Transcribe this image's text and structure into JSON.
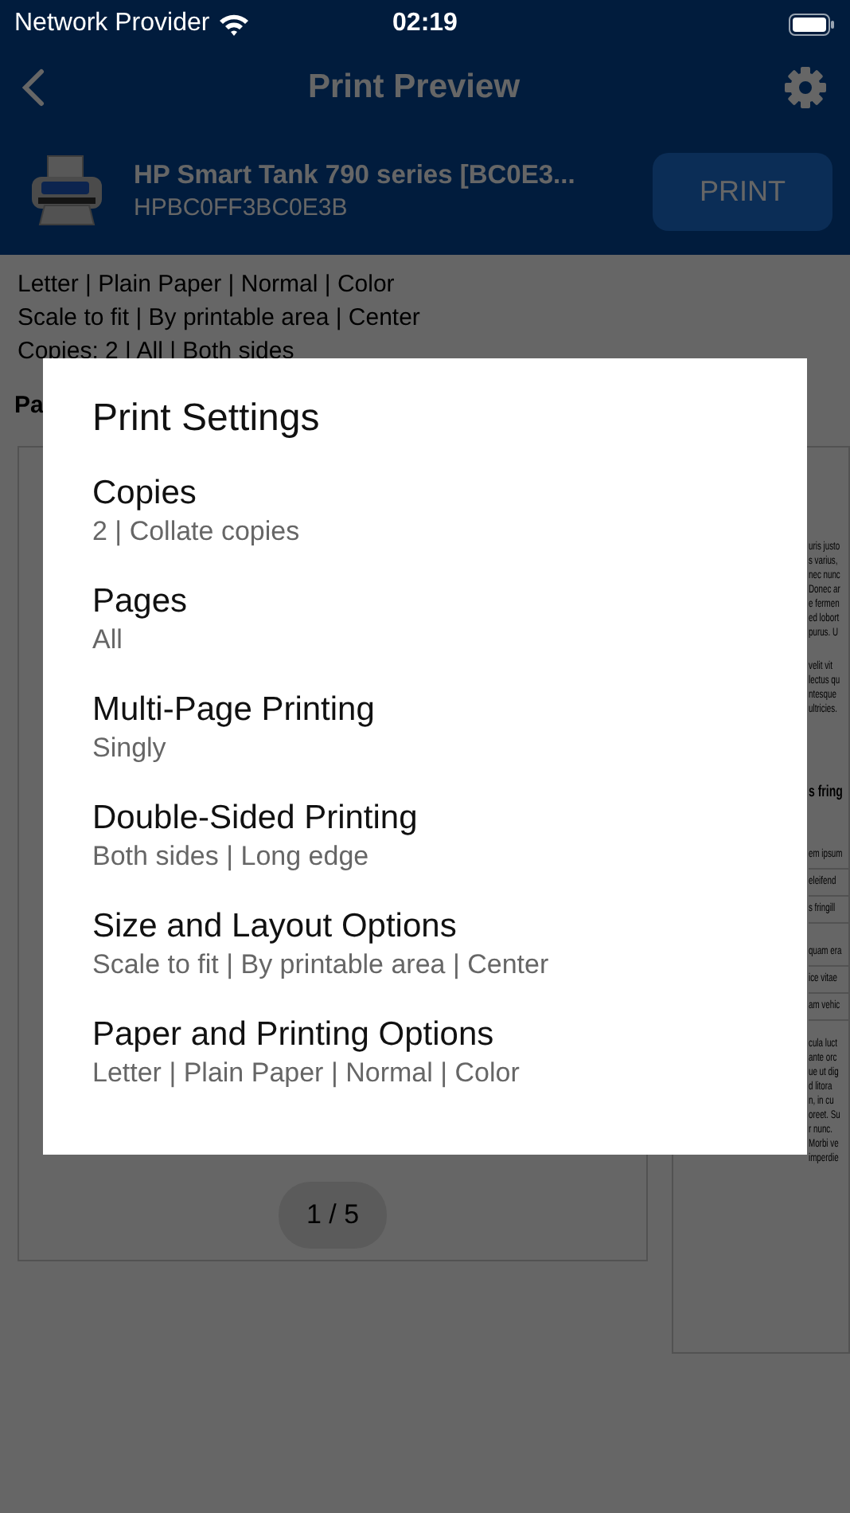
{
  "status_bar": {
    "carrier": "Network Provider",
    "time": "02:19"
  },
  "nav": {
    "title": "Print Preview"
  },
  "printer": {
    "name": "HP Smart Tank 790 series [BC0E3...",
    "id": "HPBC0FF3BC0E3B",
    "action": "PRINT"
  },
  "summary": [
    "Letter | Plain Paper | Normal | Color",
    "Scale to fit | By printable area | Center",
    "Copies: 2 | All | Both sides"
  ],
  "pages_label": "Pa",
  "preview": {
    "counter": "1 / 5",
    "side_page": [
      {
        "kind": "paragraph",
        "lines": [
          "uris justo",
          "s varius,",
          "nec nunc",
          "Donec ar",
          "e fermen",
          "ed lobort",
          "purus. U"
        ]
      },
      {
        "kind": "paragraph",
        "lines": [
          "velit vit",
          "lectus qu",
          "ntesque",
          "ultricies."
        ]
      },
      {
        "kind": "heading",
        "text": "s fring"
      },
      {
        "kind": "table",
        "rows": [
          "em ipsum",
          "eleifend",
          "s fringill"
        ]
      },
      {
        "kind": "table",
        "rows": [
          "quam era",
          "ice vitae",
          "am vehic"
        ]
      },
      {
        "kind": "paragraph",
        "lines": [
          "cula luct",
          "ante orc",
          "ue ut dig",
          "d litora",
          "n, in cu",
          "oreet. Su",
          "r nunc.",
          "Morbi ve",
          "imperdie"
        ]
      }
    ]
  },
  "dialog": {
    "title": "Print Settings",
    "items": [
      {
        "label": "Copies",
        "value": "2 | Collate copies"
      },
      {
        "label": "Pages",
        "value": "All"
      },
      {
        "label": "Multi-Page Printing",
        "value": "Singly"
      },
      {
        "label": "Double-Sided Printing",
        "value": "Both sides | Long edge"
      },
      {
        "label": "Size and Layout Options",
        "value": "Scale to fit | By printable area | Center"
      },
      {
        "label": "Paper and Printing Options",
        "value": "Letter | Plain Paper | Normal | Color"
      }
    ]
  }
}
